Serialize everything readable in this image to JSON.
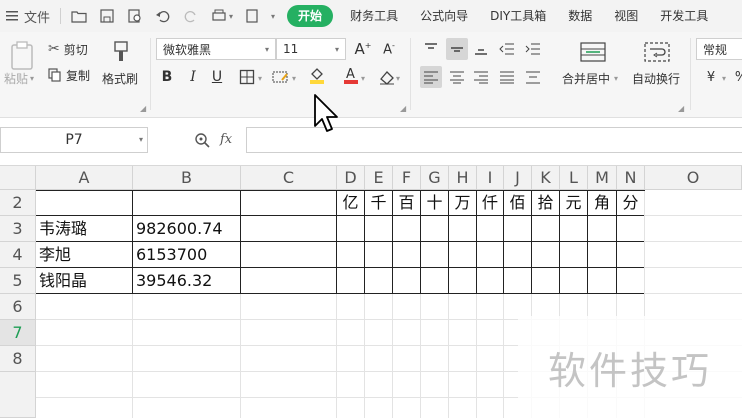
{
  "menubar": {
    "file": "文件",
    "tabs": [
      "开始",
      "财务工具",
      "公式向导",
      "DIY工具箱",
      "数据",
      "视图",
      "开发工具"
    ],
    "active_tab": "开始",
    "accent": "#25b062"
  },
  "ribbon": {
    "paste": "粘贴",
    "cut": "剪切",
    "copy": "复制",
    "format_painter": "格式刷",
    "font_name": "微软雅黑",
    "font_size": "11",
    "merge_center": "合并居中",
    "wrap_text": "自动换行",
    "number_format": "常规",
    "bold": "B",
    "italic": "I",
    "underline": "U"
  },
  "formula_bar": {
    "name_box": "P7",
    "fx": "fx",
    "formula": ""
  },
  "sheet": {
    "columns": [
      "A",
      "B",
      "C",
      "D",
      "E",
      "F",
      "G",
      "H",
      "I",
      "J",
      "K",
      "L",
      "M",
      "N",
      "O"
    ],
    "rows": [
      "2",
      "3",
      "4",
      "5",
      "6",
      "7",
      "8"
    ],
    "selected_row": "7",
    "row2_units": [
      "亿",
      "千",
      "百",
      "十",
      "万",
      "仟",
      "佰",
      "拾",
      "元",
      "角",
      "分"
    ],
    "data": [
      {
        "name": "韦涛璐",
        "amount": "982600.74"
      },
      {
        "name": "李旭",
        "amount": "6153700"
      },
      {
        "name": "钱阳晶",
        "amount": "39546.32"
      }
    ]
  },
  "watermark": "软件技巧"
}
